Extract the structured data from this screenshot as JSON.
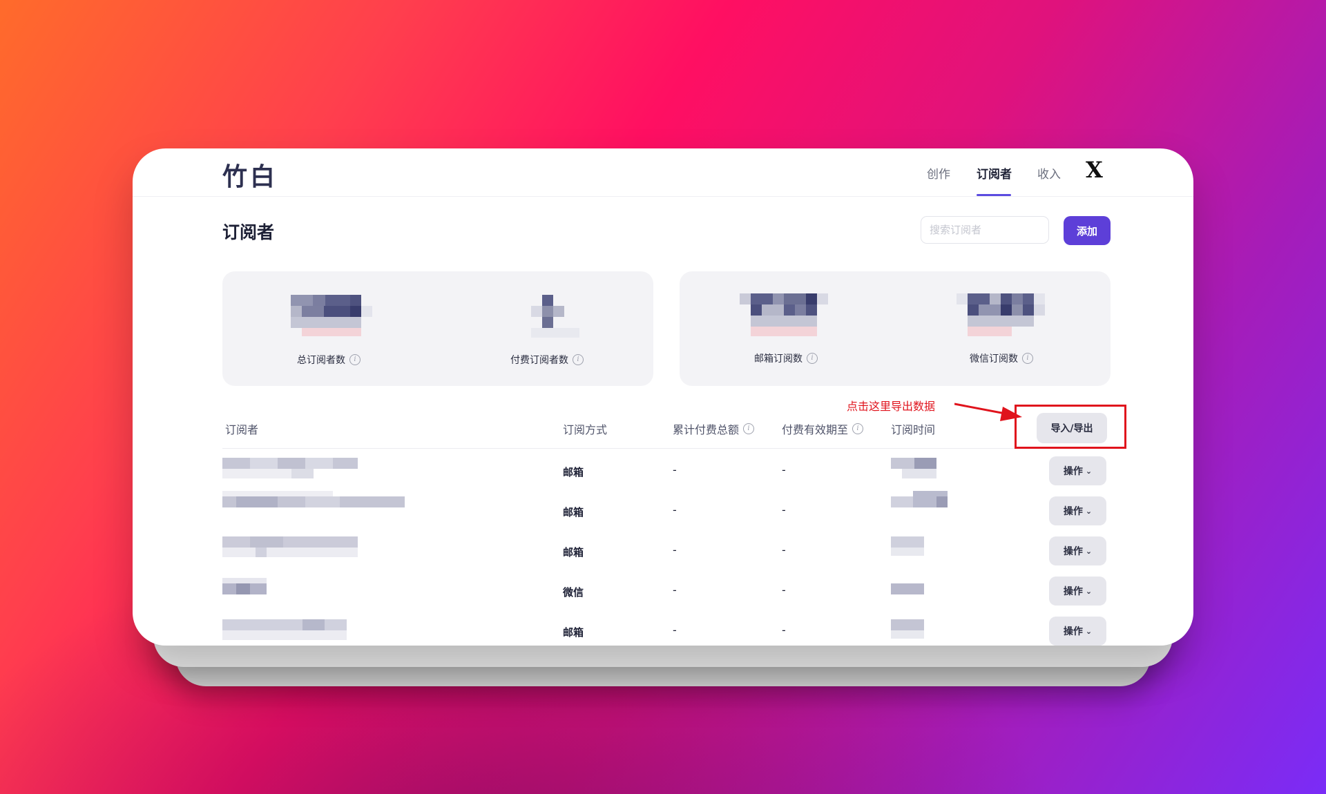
{
  "header": {
    "logo": "竹白",
    "nav": [
      {
        "label": "创作"
      },
      {
        "label": "订阅者",
        "active": true
      },
      {
        "label": "收入"
      }
    ],
    "brand_icon": "x-logo-icon"
  },
  "page": {
    "title": "订阅者",
    "search_placeholder": "搜索订阅者",
    "add_label": "添加"
  },
  "stats": [
    {
      "label": "总订阅者数",
      "value_obscured": true
    },
    {
      "label": "付费订阅者数",
      "value_obscured": true
    },
    {
      "label": "邮箱订阅数",
      "value_obscured": true
    },
    {
      "label": "微信订阅数",
      "value_obscured": true
    }
  ],
  "table": {
    "columns": [
      "订阅者",
      "订阅方式",
      "累计付费总额",
      "付费有效期至",
      "订阅时间"
    ],
    "export_label": "导入/导出",
    "rows": [
      {
        "subscriber_obscured": true,
        "method": "邮箱",
        "total_paid": "-",
        "expiry": "-",
        "time_obscured": true,
        "action": "操作"
      },
      {
        "subscriber_obscured": true,
        "method": "邮箱",
        "total_paid": "-",
        "expiry": "-",
        "time_obscured": true,
        "action": "操作"
      },
      {
        "subscriber_obscured": true,
        "method": "邮箱",
        "total_paid": "-",
        "expiry": "-",
        "time_obscured": true,
        "action": "操作"
      },
      {
        "subscriber_obscured": true,
        "method": "微信",
        "total_paid": "-",
        "expiry": "-",
        "time_obscured": true,
        "action": "操作"
      },
      {
        "subscriber_obscured": true,
        "method": "邮箱",
        "total_paid": "-",
        "expiry": "-",
        "time_obscured": true,
        "action": "操作"
      }
    ]
  },
  "annotation": {
    "text": "点击这里导出数据",
    "color": "#e0131c"
  },
  "colors": {
    "accent": "#5d3fd8",
    "text_dark": "#1d2035",
    "panel_bg": "#f3f3f6"
  }
}
